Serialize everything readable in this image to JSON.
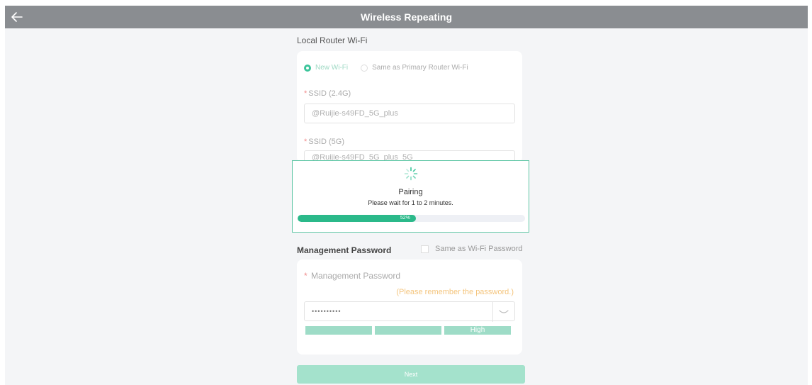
{
  "header": {
    "title": "Wireless Repeating",
    "back_icon": "back-arrow-icon"
  },
  "local_wifi": {
    "section_label": "Local Router Wi-Fi",
    "radio_options": [
      {
        "label": "New Wi-Fi",
        "selected": true
      },
      {
        "label": "Same as Primary Router Wi-Fi",
        "selected": false
      }
    ],
    "ssid_24_label": "SSID (2.4G)",
    "ssid_24_value": "@Ruijie-s49FD_5G_plus",
    "ssid_5_label": "SSID (5G)",
    "ssid_5_value": "@Ruijie-s49FD_5G_plus_5G",
    "required_mark": "*"
  },
  "pairing": {
    "title": "Pairing",
    "message": "Please wait for 1 to 2 minutes.",
    "progress_percent": 52,
    "progress_label": "52%"
  },
  "management": {
    "section_label": "Management Password",
    "same_as_wifi_label": "Same as Wi-Fi Password",
    "same_as_wifi_checked": false,
    "field_label": "Management Password",
    "hint": "(Please remember the password.)",
    "password_mask": "••••••••••",
    "strength_level": "High",
    "strength_segments": 3
  },
  "footer": {
    "next_label": "Next"
  },
  "colors": {
    "header_bg": "#8a8d91",
    "accent": "#2bb98a",
    "hint": "#f4c57e"
  }
}
